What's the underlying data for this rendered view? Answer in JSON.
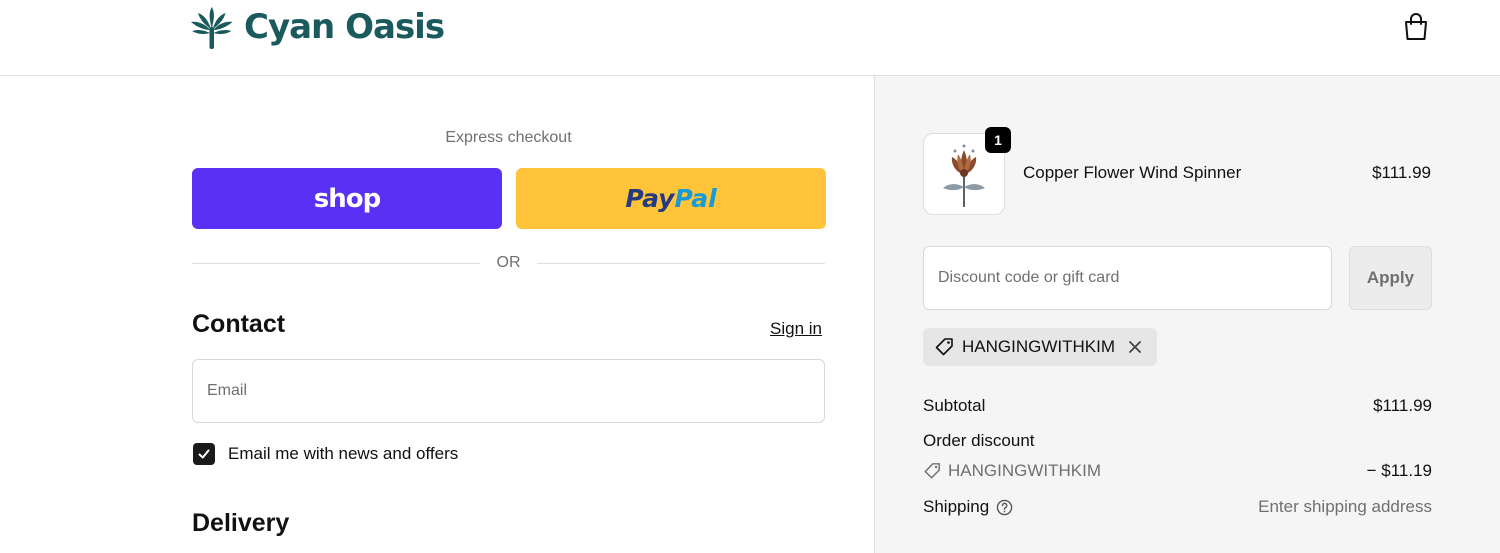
{
  "header": {
    "brand_name": "Cyan Oasis",
    "brand_color": "#1b5a5c",
    "logo_icon": "palm-leaf-icon",
    "cart_icon": "shopping-bag-icon"
  },
  "express": {
    "label": "Express checkout",
    "shop_label": "shop",
    "shop_color": "#5a31f4",
    "paypal_label_part1": "Pay",
    "paypal_label_part2": "Pal",
    "paypal_color": "#ffc439",
    "divider_label": "OR"
  },
  "contact": {
    "title": "Contact",
    "sign_in_label": "Sign in",
    "email_placeholder": "Email",
    "newsletter_label": "Email me with news and offers",
    "newsletter_checked": true
  },
  "delivery": {
    "title": "Delivery"
  },
  "summary": {
    "item": {
      "name": "Copper Flower Wind Spinner",
      "price": "$111.99",
      "quantity": "1"
    },
    "discount_placeholder": "Discount code or gift card",
    "apply_label": "Apply",
    "applied_code": "HANGINGWITHKIM",
    "subtotal_label": "Subtotal",
    "subtotal_value": "$111.99",
    "order_discount_label": "Order discount",
    "discount_code": "HANGINGWITHKIM",
    "discount_value": "− $11.19",
    "shipping_label": "Shipping",
    "shipping_value": "Enter shipping address"
  }
}
